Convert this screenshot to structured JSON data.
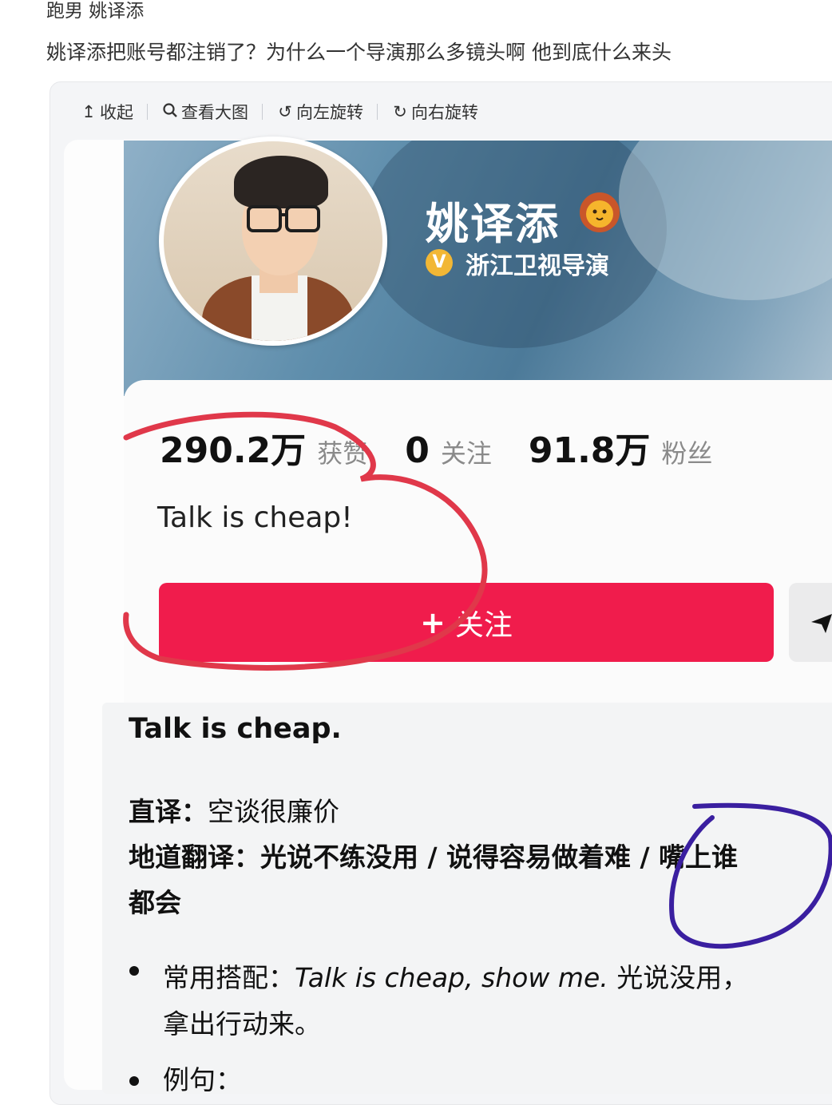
{
  "post": {
    "tags": "跑男 姚译添",
    "headline": "姚译添把账号都注销了？为什么一个导演那么多镜头啊 他到底什么来头"
  },
  "toolbar": {
    "collapse_label": "收起",
    "view_large_label": "查看大图",
    "rotate_left_label": "向左旋转",
    "rotate_right_label": "向右旋转",
    "collapse_icon": "arrow-up-icon",
    "view_large_icon": "magnifier-icon",
    "rotate_left_icon": "rotate-left-icon",
    "rotate_right_icon": "rotate-right-icon"
  },
  "profile": {
    "name": "姚译添",
    "verified_title": "浙江卫视导演",
    "verified_badge": "V",
    "stats": [
      {
        "value": "290.2万",
        "label": "获赞"
      },
      {
        "value": "0",
        "label": "关注"
      },
      {
        "value": "91.8万",
        "label": "粉丝"
      }
    ],
    "bio": "Talk is cheap!",
    "follow_label": "关注",
    "follow_icon": "+",
    "dm_icon": "send-icon",
    "accent_color": "#f01c4c"
  },
  "dictionary": {
    "heading": "Talk is cheap.",
    "literal_label": "直译：",
    "literal_text": "空谈很廉价",
    "idiomatic_label": "地道翻译：",
    "idiomatic_text_1": "光说不练没用 / 说得容易做着难 / 嘴上谁",
    "idiomatic_text_2": "都会",
    "collocation_label": "常用搭配：",
    "collocation_en": "Talk is cheap, show me.",
    "collocation_zh_1": "光说没用，",
    "collocation_zh_2": "拿出行动来。",
    "example_label": "例句："
  },
  "annotations": {
    "circle_1_color": "#e0384a",
    "circle_2_color": "#3a1fa0"
  }
}
